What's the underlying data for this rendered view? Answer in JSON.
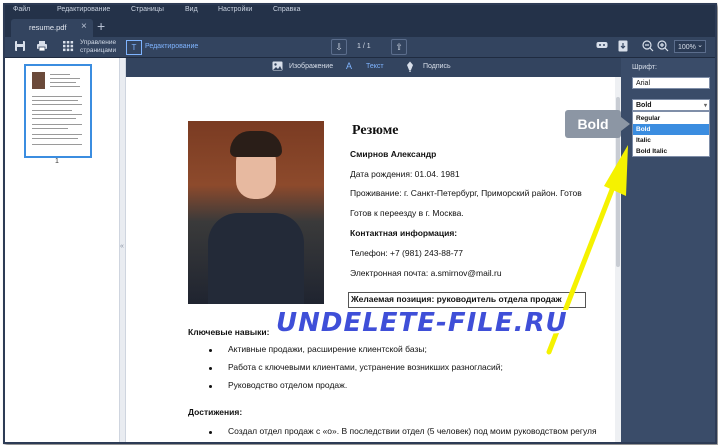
{
  "menu": [
    "Файл",
    "Редактирование",
    "Страницы",
    "Вид",
    "Настройки",
    "Справка"
  ],
  "tab": {
    "label": "resume.pdf",
    "close": "×",
    "add": "+"
  },
  "toolbar": {
    "pages_line1": "Управление",
    "pages_line2": "страницами",
    "edit_label": "Редактирование",
    "page_counter": "1 / 1",
    "zoom": "100%",
    "zoom_chevron": "⌄"
  },
  "subtoolbar": {
    "image": "Изображение",
    "text": "Текст",
    "signature": "Подпись"
  },
  "thumbnail": {
    "page_number": "1"
  },
  "resume": {
    "title": "Резюме",
    "name": "Смирнов Александр",
    "birth": "Дата рождения: 01.04. 1981",
    "residence": "Проживание: г. Санкт-Петербург, Приморский район. Готов",
    "relocate": "Готов к переезду в г. Москва.",
    "contacts_heading": "Контактная информация:",
    "phone": "Телефон: +7 (981) 243-88-77",
    "email": "Электронная почта: a.smirnov@mail.ru",
    "position": "Желаемая позиция: руководитель отдела продаж",
    "skills_heading": "Ключевые навыки:",
    "skills": [
      "Активные продажи, расширение клиентской базы;",
      "Работа с ключевыми клиентами, устранение возникших разногласий;",
      "Руководство отделом продаж."
    ],
    "achievements_heading": "Достижения:",
    "achievements": [
      "Создал отдел продаж с «о». В последствии отдел (5 человек) под моим руководством регуля"
    ]
  },
  "right_panel": {
    "font_label": "Шрифт:",
    "font_value": "Arial",
    "style_value": "Bold",
    "style_options": [
      "Regular",
      "Bold",
      "Italic",
      "Bold Italic"
    ],
    "selected_index": 1
  },
  "callout": "Bold",
  "watermark": "UNDELETE-FILE.RU",
  "colors": {
    "accent": "#3b8de0",
    "highlight_yellow": "#f5f200",
    "watermark_blue": "#3f4fd8"
  }
}
